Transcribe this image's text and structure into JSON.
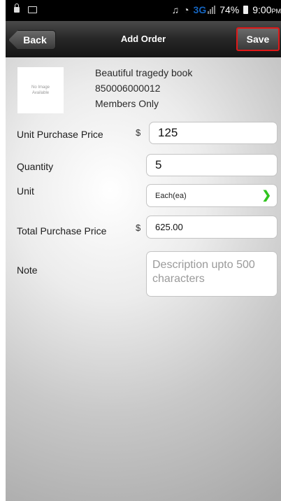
{
  "status_bar": {
    "network": "3G",
    "battery": "74%",
    "time": "9:00",
    "ampm": "PM"
  },
  "nav": {
    "back_label": "Back",
    "title": "Add Order",
    "save_label": "Save"
  },
  "product": {
    "image_placeholder_line1": "No Image",
    "image_placeholder_line2": "Available",
    "name": "Beautiful tragedy book",
    "code": "850006000012",
    "membership": "Members Only"
  },
  "form": {
    "unit_purchase_price": {
      "label": "Unit Purchase Price",
      "currency": "$",
      "value": "125"
    },
    "quantity": {
      "label": "Quantity",
      "value": "5"
    },
    "unit": {
      "label": "Unit",
      "value": "Each(ea)"
    },
    "total_purchase_price": {
      "label": "Total Purchase Price",
      "currency": "$",
      "value": "625.00"
    },
    "note": {
      "label": "Note",
      "placeholder": "Description upto 500 characters"
    }
  },
  "colors": {
    "save_highlight": "#e01818",
    "chevron": "#2fc41e",
    "network": "#1565c0"
  },
  "icons": [
    "lock-icon",
    "photo-icon",
    "headphones-icon",
    "wifi-icon",
    "signal-icon",
    "battery-icon",
    "chevron-right-icon"
  ]
}
